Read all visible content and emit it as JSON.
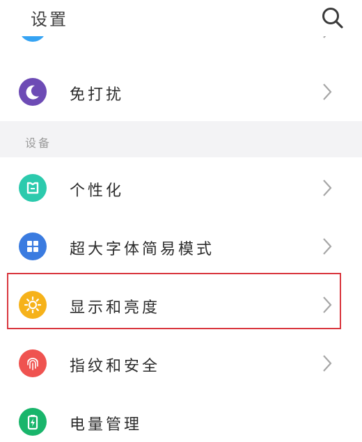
{
  "header": {
    "title": "设置"
  },
  "partial_row": {
    "icon": "blue-circle-icon",
    "icon_color": "#35a3f3"
  },
  "rows_top": [
    {
      "label": "免打扰",
      "icon": "moon-icon",
      "icon_color": "#6d4bb5"
    }
  ],
  "section": {
    "title": "设备"
  },
  "rows": [
    {
      "label": "个性化",
      "icon": "theme-icon",
      "icon_color": "#2ccaad"
    },
    {
      "label": "超大字体简易模式",
      "icon": "grid-icon",
      "icon_color": "#3a7be0"
    },
    {
      "label": "显示和亮度",
      "icon": "sun-icon",
      "icon_color": "#f6b21a"
    },
    {
      "label": "指纹和安全",
      "icon": "fingerprint-icon",
      "icon_color": "#ef5350"
    },
    {
      "label": "电量管理",
      "icon": "battery-icon",
      "icon_color": "#19b56b"
    }
  ],
  "highlight": {
    "target": "显示和亮度",
    "color": "#d9363e"
  }
}
